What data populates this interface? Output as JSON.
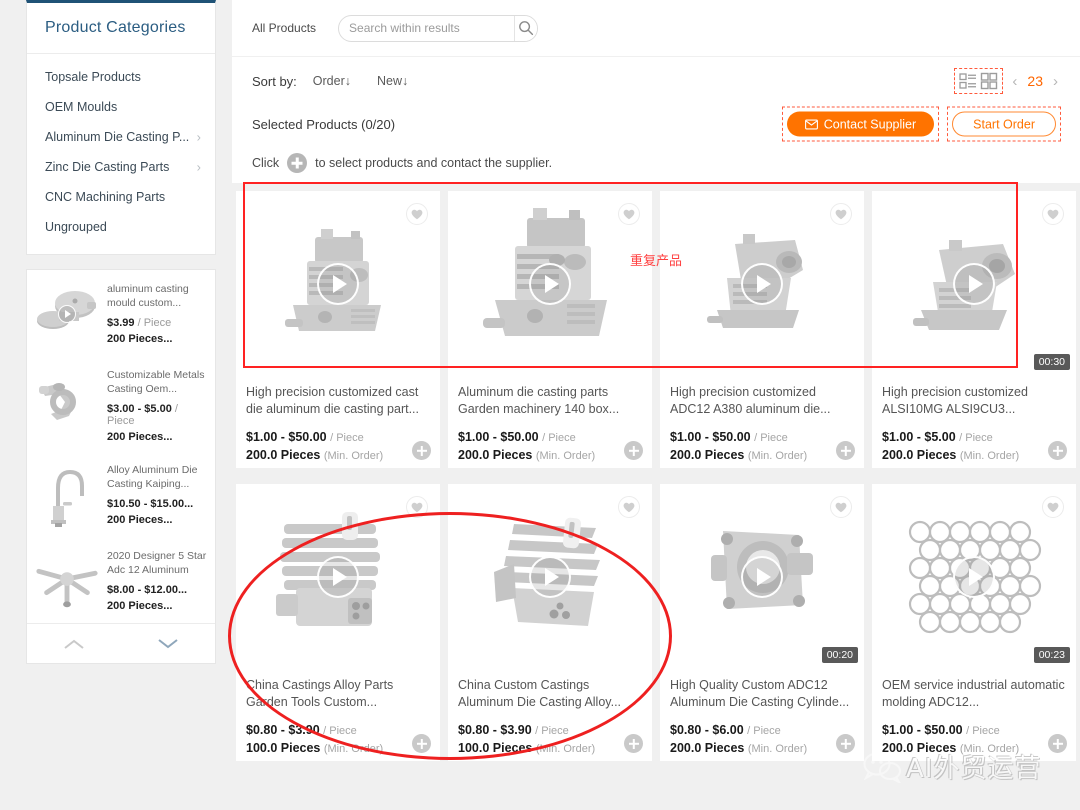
{
  "sidebar": {
    "categories_title": "Product Categories",
    "categories": [
      {
        "label": "Topsale Products",
        "has_children": false
      },
      {
        "label": "OEM Moulds",
        "has_children": false
      },
      {
        "label": "Aluminum Die Casting P...",
        "has_children": true
      },
      {
        "label": "Zinc Die Casting Parts",
        "has_children": true
      },
      {
        "label": "CNC Machining Parts",
        "has_children": false
      },
      {
        "label": "Ungrouped",
        "has_children": false
      }
    ],
    "mini_products": [
      {
        "name": "aluminum casting mould custom...",
        "price": "$3.99",
        "unit": "/ Piece",
        "moq": "200 Pieces...",
        "has_video": true,
        "shape": "housing"
      },
      {
        "name": "Customizable Metals Casting Oem...",
        "price": "$3.00 - $5.00",
        "unit": "/ Piece",
        "moq": "200 Pieces...",
        "has_video": false,
        "shape": "fork"
      },
      {
        "name": "Alloy Aluminum Die Casting Kaiping...",
        "price": "$10.50 - $15.00...",
        "unit": "",
        "moq": "200 Pieces...",
        "has_video": false,
        "shape": "faucet"
      },
      {
        "name": "2020 Designer 5 Star Adc 12 Aluminum D...",
        "price": "$8.00 - $12.00...",
        "unit": "",
        "moq": "200 Pieces...",
        "has_video": false,
        "shape": "star"
      }
    ],
    "nav_up_icon": "chevron-up-icon",
    "nav_down_icon": "chevron-down-icon"
  },
  "topbar": {
    "all_products_label": "All Products",
    "search_placeholder": "Search within results",
    "search_value": "",
    "search_icon": "search-icon"
  },
  "sortbar": {
    "sort_label": "Sort by:",
    "options": [
      {
        "label": "Order↓"
      },
      {
        "label": "New↓"
      }
    ],
    "view_list_icon": "list-view-icon",
    "view_grid_icon": "grid-view-icon",
    "prev_icon": "chevron-left-icon",
    "next_icon": "chevron-right-icon",
    "page_number": "23"
  },
  "selection": {
    "selected_text": "Selected Products (0/20)",
    "contact_label": "Contact Supplier",
    "contact_icon": "envelope-icon",
    "start_order_label": "Start Order",
    "hint_prefix": "Click",
    "hint_suffix": "to select products and contact the supplier.",
    "hint_icon": "plus-circle-icon"
  },
  "products": [
    {
      "title": "High precision customized cast die aluminum die casting part...",
      "price": "$1.00 - $50.00",
      "unit": "/ Piece",
      "moq": "200.0 Pieces",
      "moq_sub": "(Min. Order)",
      "duration": "",
      "shape": "engine-a"
    },
    {
      "title": "Aluminum die casting parts Garden machinery 140 box...",
      "price": "$1.00 - $50.00",
      "unit": "/ Piece",
      "moq": "200.0 Pieces",
      "moq_sub": "(Min. Order)",
      "duration": "",
      "shape": "engine-b"
    },
    {
      "title": "High precision customized ADC12 A380 aluminum die...",
      "price": "$1.00 - $50.00",
      "unit": "/ Piece",
      "moq": "200.0 Pieces",
      "moq_sub": "(Min. Order)",
      "duration": "",
      "shape": "engine-c"
    },
    {
      "title": "High precision customized ALSI10MG ALSI9CU3...",
      "price": "$1.00 - $5.00",
      "unit": "/ Piece",
      "moq": "200.0 Pieces",
      "moq_sub": "(Min. Order)",
      "duration": "00:30",
      "shape": "engine-d"
    },
    {
      "title": "China Castings Alloy Parts Garden Tools Custom...",
      "price": "$0.80 - $3.90",
      "unit": "/ Piece",
      "moq": "100.0 Pieces",
      "moq_sub": "(Min. Order)",
      "duration": "",
      "shape": "cylinder-a"
    },
    {
      "title": "China Custom Castings Aluminum Die Casting Alloy...",
      "price": "$0.80 - $3.90",
      "unit": "/ Piece",
      "moq": "100.0 Pieces",
      "moq_sub": "(Min. Order)",
      "duration": "",
      "shape": "cylinder-b"
    },
    {
      "title": "High Quality Custom ADC12 Aluminum Die Casting Cylinde...",
      "price": "$0.80 - $6.00",
      "unit": "/ Piece",
      "moq": "200.0 Pieces",
      "moq_sub": "(Min. Order)",
      "duration": "00:20",
      "shape": "block"
    },
    {
      "title": "OEM service industrial automatic molding ADC12...",
      "price": "$1.00 - $50.00",
      "unit": "/ Piece",
      "moq": "200.0 Pieces",
      "moq_sub": "(Min. Order)",
      "duration": "00:23",
      "shape": "honeycomb"
    }
  ],
  "annotations": {
    "duplicate_label": "重复产品",
    "rect_color": "#ff2222",
    "ellipse_color": "#ee2020"
  },
  "watermark": {
    "text": "AI外贸运营",
    "icon": "wechat-icon"
  },
  "colors": {
    "accent_orange": "#ff7300",
    "sidebar_blue": "#2b5d82",
    "annotation_red": "#ff2222"
  }
}
